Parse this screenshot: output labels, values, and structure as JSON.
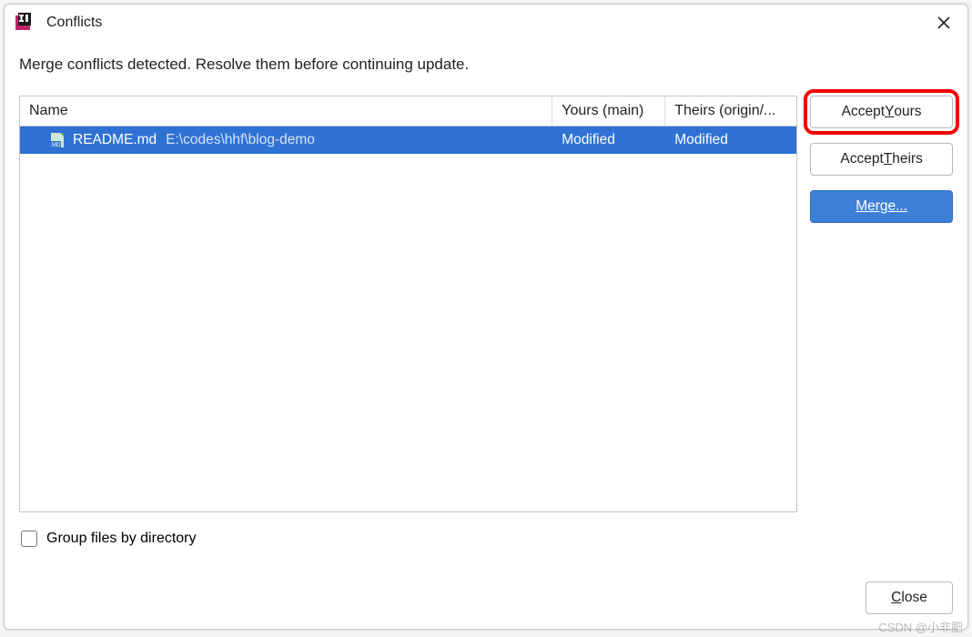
{
  "titlebar": {
    "title": "Conflicts"
  },
  "message": "Merge conflicts detected. Resolve them before continuing update.",
  "table": {
    "headers": {
      "name": "Name",
      "yours": "Yours (main)",
      "theirs": "Theirs (origin/..."
    },
    "rows": [
      {
        "filename": "README.md",
        "path": "E:\\codes\\hhf\\blog-demo",
        "yours": "Modified",
        "theirs": "Modified"
      }
    ]
  },
  "buttons": {
    "accept_yours_pre": "Accept ",
    "accept_yours_m": "Y",
    "accept_yours_post": "ours",
    "accept_theirs_pre": "Accept ",
    "accept_theirs_m": "T",
    "accept_theirs_post": "heirs",
    "merge": "Merge...",
    "close_pre": "",
    "close_m": "C",
    "close_post": "lose"
  },
  "group_label": "Group files by directory",
  "watermark": "CSDN @小非肥"
}
